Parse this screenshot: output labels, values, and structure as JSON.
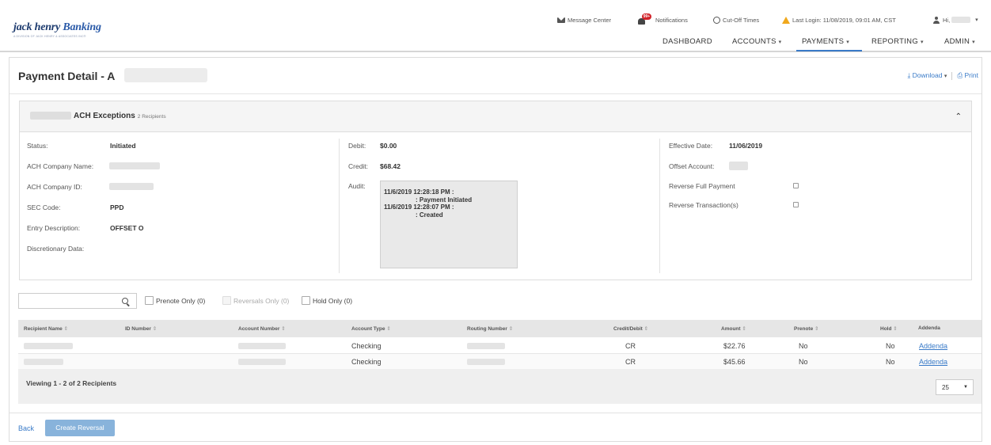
{
  "brand": {
    "name_part1": "jack henry",
    "name_part2": " Banking",
    "tagline": "A DIVISION OF JACK HENRY & ASSOCIATES INC®"
  },
  "utility": {
    "message_center": "Message Center",
    "notifications": "Notifications",
    "notifications_badge": "99+",
    "cutoff_times": "Cut-Off Times",
    "last_login": "Last Login: 11/08/2019, 09:01 AM, CST",
    "greeting": "Hi,"
  },
  "nav": {
    "dashboard": "DASHBOARD",
    "accounts": "ACCOUNTS",
    "payments": "PAYMENTS",
    "reporting": "REPORTING",
    "admin": "ADMIN",
    "active": "PAYMENTS"
  },
  "page": {
    "title": "Payment Detail - A",
    "download": "Download",
    "print": "Print"
  },
  "panel": {
    "title": "ACH Exceptions",
    "recipients_count": "2 Recipients",
    "left": {
      "status_label": "Status:",
      "status_value": "Initiated",
      "company_name_label": "ACH Company Name:",
      "company_id_label": "ACH Company ID:",
      "sec_code_label": "SEC Code:",
      "sec_code_value": "PPD",
      "entry_desc_label": "Entry Description:",
      "entry_desc_value": "OFFSET O",
      "discretionary_label": "Discretionary Data:"
    },
    "middle": {
      "debit_label": "Debit:",
      "debit_value": "$0.00",
      "credit_label": "Credit:",
      "credit_value": "$68.42",
      "audit_label": "Audit:",
      "audit_lines": [
        "11/6/2019 12:28:18 PM :",
        ": Payment Initiated",
        "11/6/2019 12:28:07 PM :",
        ": Created"
      ]
    },
    "right": {
      "effective_date_label": "Effective Date:",
      "effective_date_value": "11/06/2019",
      "offset_account_label": "Offset Account:",
      "reverse_full_label": "Reverse Full Payment",
      "reverse_txn_label": "Reverse Transaction(s)"
    }
  },
  "filters": {
    "search_placeholder": "",
    "prenote_only": "Prenote Only (0)",
    "reversals_only": "Reversals Only (0)",
    "hold_only": "Hold Only (0)"
  },
  "table": {
    "columns": [
      "Recipient Name",
      "ID Number",
      "Account Number",
      "Account Type",
      "Routing Number",
      "Credit/Debit",
      "Amount",
      "Prenote",
      "Hold",
      "Addenda"
    ],
    "rows": [
      {
        "account_type": "Checking",
        "credit_debit": "CR",
        "amount": "$22.76",
        "prenote": "No",
        "hold": "No",
        "addenda": "Addenda"
      },
      {
        "account_type": "Checking",
        "credit_debit": "CR",
        "amount": "$45.66",
        "prenote": "No",
        "hold": "No",
        "addenda": "Addenda"
      }
    ],
    "viewing": "Viewing 1 - 2 of 2 Recipients",
    "page_size": "25"
  },
  "footer": {
    "back": "Back",
    "create_reversal": "Create Reversal"
  },
  "colors": {
    "accent": "#3a7bc8",
    "primary_button_disabled": "#88b3db",
    "warning": "#f0a81c",
    "badge": "#d2232a"
  }
}
